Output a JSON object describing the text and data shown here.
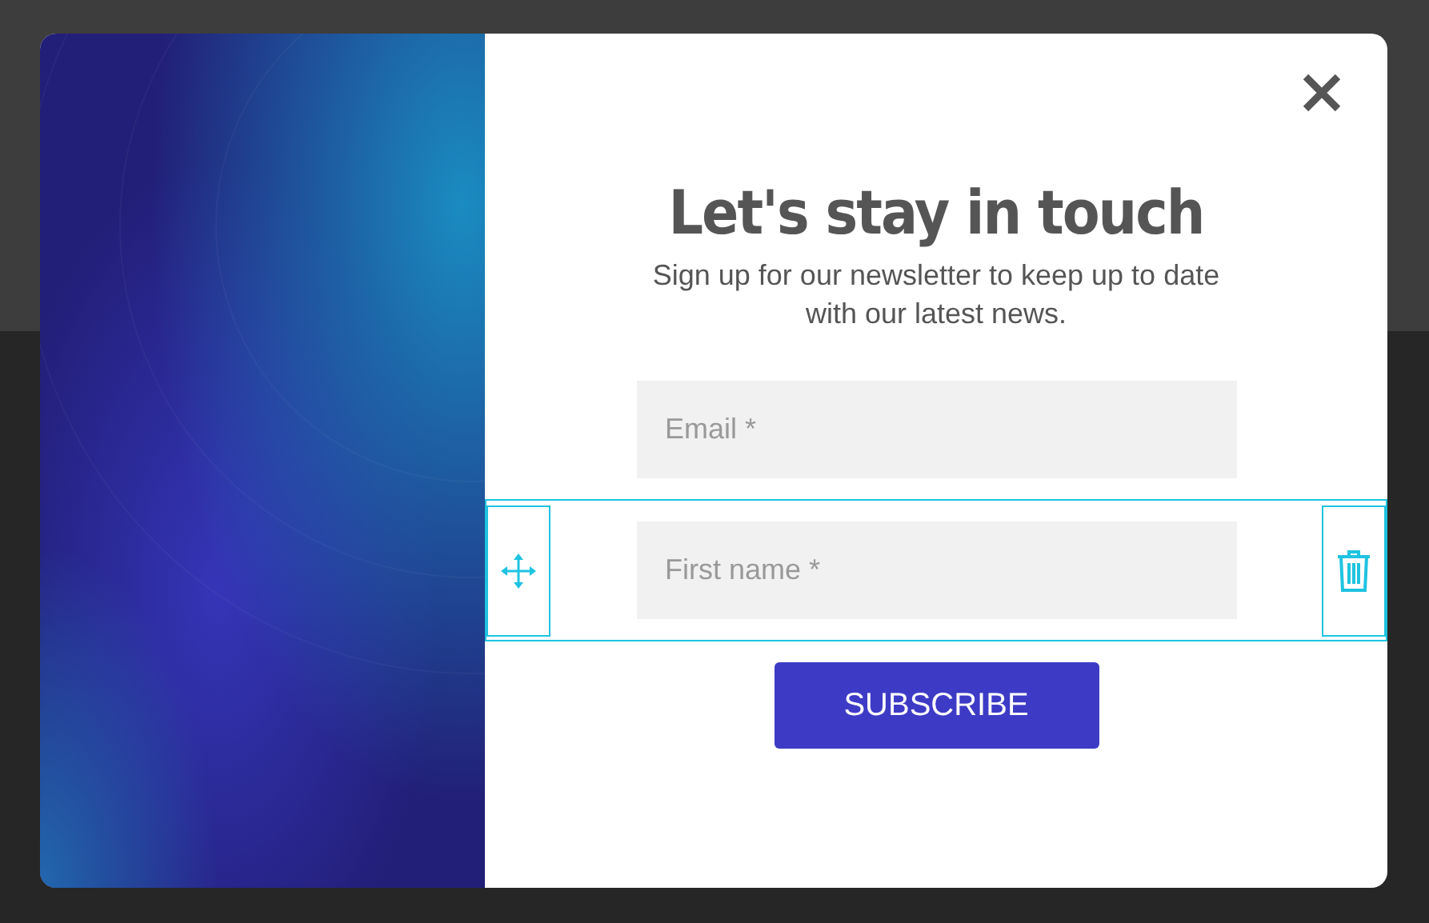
{
  "popup": {
    "title": "Let's stay in touch",
    "subtitle": "Sign up for our newsletter to keep up to date with our latest news.",
    "fields": [
      {
        "placeholder": "Email *",
        "selected": false
      },
      {
        "placeholder": "First name *",
        "selected": true
      }
    ],
    "button": "SUBSCRIBE"
  }
}
